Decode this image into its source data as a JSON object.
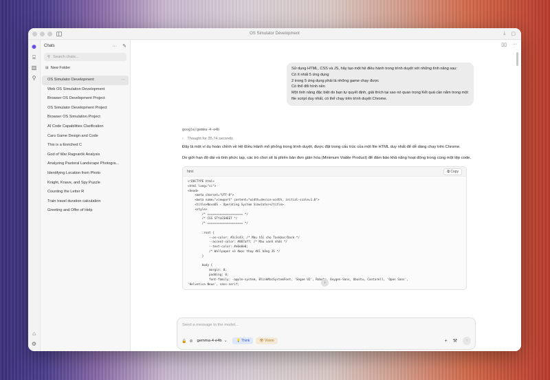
{
  "window": {
    "title": "OS Simulator Development"
  },
  "sidebar": {
    "header": "Chats",
    "search_placeholder": "Search chats...",
    "new_folder": "New Folder",
    "items": [
      {
        "label": "OS Simulator Development",
        "active": true
      },
      {
        "label": "Web OS Simulation Development"
      },
      {
        "label": "Browser OS Development Project"
      },
      {
        "label": "OS Simulator Development Project"
      },
      {
        "label": "Browser OS Simulation Project"
      },
      {
        "label": "AI Code Capabilities Clarification"
      },
      {
        "label": "Caro Game Design and Code"
      },
      {
        "label": "This is a Enriched C"
      },
      {
        "label": "God of War Ragnarök Analysis"
      },
      {
        "label": "Analyzing Pastoral Landscape Photogra..."
      },
      {
        "label": "Identifying Location from Photo"
      },
      {
        "label": "Knight, Knave, and Spy Puzzle"
      },
      {
        "label": "Counting the Letter R"
      },
      {
        "label": "Train travel duration calculation"
      },
      {
        "label": "Greeting and Offer of Help"
      }
    ]
  },
  "conversation": {
    "user_message": [
      "Sử dụng HTML, CSS và JS, hãy tạo một hệ điều hành trong trình duyệt với những tính năng sau:",
      "Có ít nhất 5 ứng dụng",
      "2 trong 5 ứng dụng phải là những game chạy được",
      "Có thể đổi hình nền",
      "Một tính năng đặc biệt do bạn tự quyết định, giải thích tại sao nó quan trọng Kết quả cần nằm trong một file script duy nhất, có thể chạy trên trình duyệt Chrome."
    ],
    "model_name": "google/gemma-4-e4b",
    "thought": "Thought for 35.74 seconds",
    "paragraph_1": "Đây là một ví dụ hoàn chỉnh về Hệ Điều Hành mô phỏng trong trình duyệt, được đặt trong cấu trúc của một file HTML duy nhất để dễ dàng chạy trên Chrome.",
    "paragraph_2": "Do giới hạn độ dài và tính phức tạp, các trò chơi sẽ là phiên bản đơn giản hóa (Minimum Viable Product) để đảm bảo khả năng hoạt động trong cùng một tệp code.",
    "code_lang": "html",
    "copy_label": "Copy",
    "code": "<!DOCTYPE html>\n<html lang=\"vi\">\n<head>\n    <meta charset=\"UTF-8\">\n    <meta name=\"viewport\" content=\"width=device-width, initial-scale=1.0\">\n    <title>NovaOS - Operating System Simulator</title>\n    <style>\n        /* ==================== */\n        /* CSS STYLESHEET */\n        /* ==================== */\n\n        :root {\n            --os-color: #3c3c43; /* Màu tối cho Taskbar/Dock */\n            --accent-color: #007aff; /* Màu xanh nhấn */\n            --text-color: #e0e0e0;\n            /* Wallpaper sẽ được thay đổi bằng JS */\n        }\n\n        body {\n            margin: 0;\n            padding: 0;\n            font-family: -apple-system, BlinkMacSystemFont, 'Segoe UI', Roboto, Oxygen-Sans, Ubuntu, Cantarell, 'Open Sans',\n'Helvetica Neue', sans-serif;"
  },
  "composer": {
    "placeholder": "Send a message to the model...",
    "model": "gemma-4-e4b",
    "think_label": "Think",
    "vision_label": "Vision"
  }
}
